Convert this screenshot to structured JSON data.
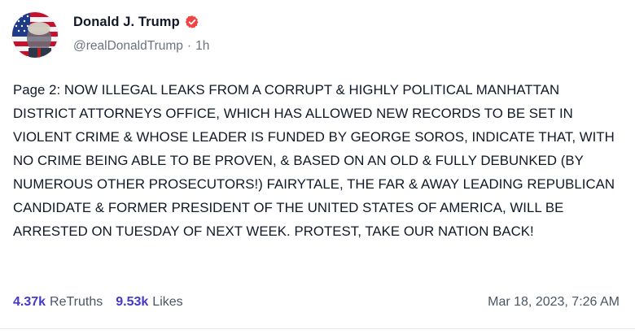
{
  "author": {
    "display_name": "Donald J. Trump",
    "handle": "@realDonaldTrump",
    "separator": "·",
    "time_ago": "1h",
    "verified": true,
    "verified_color": "#ef4444"
  },
  "post": {
    "text": "Page 2: NOW ILLEGAL LEAKS FROM A CORRUPT & HIGHLY POLITICAL MANHATTAN DISTRICT ATTORNEYS OFFICE, WHICH HAS ALLOWED NEW RECORDS TO BE SET IN VIOLENT CRIME & WHOSE LEADER IS FUNDED BY GEORGE SOROS, INDICATE THAT, WITH NO CRIME BEING ABLE TO BE PROVEN, & BASED ON AN OLD & FULLY DEBUNKED (BY NUMEROUS OTHER PROSECUTORS!) FAIRYTALE, THE FAR & AWAY LEADING REPUBLICAN CANDIDATE & FORMER PRESIDENT OF THE UNITED STATES OF AMERICA, WILL BE ARRESTED ON TUESDAY OF NEXT WEEK. PROTEST, TAKE OUR NATION BACK!"
  },
  "stats": {
    "retruths_count": "4.37k",
    "retruths_label": "ReTruths",
    "likes_count": "9.53k",
    "likes_label": "Likes"
  },
  "timestamp": "Mar 18, 2023, 7:26 AM",
  "colors": {
    "accent": "#4338ca",
    "text": "#111827",
    "muted": "#6b7280"
  },
  "icons": {
    "verified": "verified-badge-icon"
  }
}
